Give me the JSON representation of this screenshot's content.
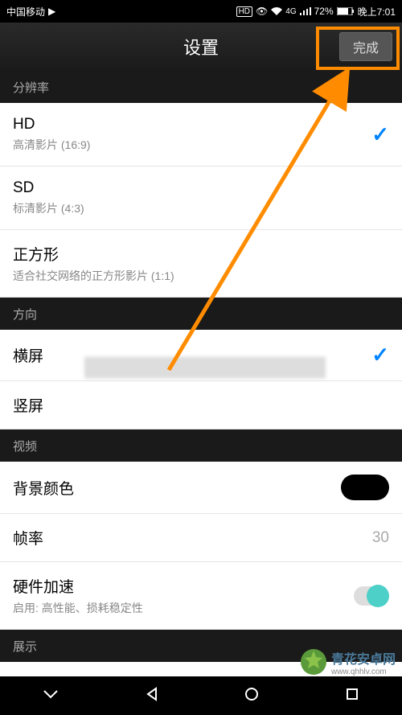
{
  "status_bar": {
    "carrier": "中国移动",
    "hd_badge": "HD",
    "signal_4g": "4G",
    "battery": "72%",
    "time": "晚上7:01"
  },
  "header": {
    "title": "设置",
    "done_label": "完成"
  },
  "sections": {
    "resolution": {
      "header": "分辨率",
      "items": [
        {
          "title": "HD",
          "subtitle": "高清影片 (16:9)",
          "selected": true
        },
        {
          "title": "SD",
          "subtitle": "标清影片 (4:3)",
          "selected": false
        },
        {
          "title": "正方形",
          "subtitle": "适合社交网络的正方形影片 (1:1)",
          "selected": false
        }
      ]
    },
    "orientation": {
      "header": "方向",
      "items": [
        {
          "title": "横屏",
          "selected": true
        },
        {
          "title": "竖屏",
          "selected": false
        }
      ]
    },
    "video": {
      "header": "视频",
      "bg_color": {
        "title": "背景颜色",
        "value_color": "#000000"
      },
      "frame_rate": {
        "title": "帧率",
        "value": "30"
      },
      "hw_accel": {
        "title": "硬件加速",
        "subtitle": "启用: 高性能、损耗稳定性",
        "enabled": true
      }
    },
    "display": {
      "header": "展示"
    }
  },
  "watermark": {
    "title": "青花安卓网",
    "url": "www.qhhlv.com"
  },
  "colors": {
    "accent_check": "#0084ff",
    "highlight": "#ff8c00",
    "toggle_on": "#4dd0c8"
  }
}
